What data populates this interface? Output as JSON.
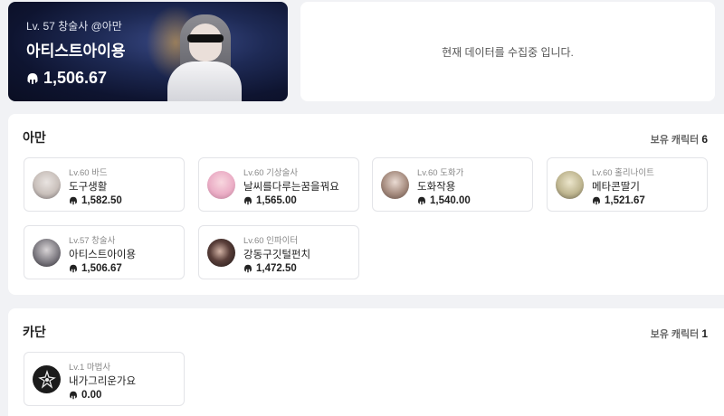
{
  "hero": {
    "meta": "Lv. 57 창술사 @아만",
    "name": "아티스트아이용",
    "item_level": "1,506.67",
    "icon": "helmet-icon"
  },
  "status": {
    "message": "현재 데이터를 수집중 입니다."
  },
  "servers": [
    {
      "name": "아만",
      "count_label": "보유 캐릭터",
      "count": "6",
      "characters": [
        {
          "level_class": "Lv.60 바드",
          "name": "도구생활",
          "item_level": "1,582.50",
          "avatar_color": "#d9d3cf"
        },
        {
          "level_class": "Lv.60 기상술사",
          "name": "날씨를다루는꿈을꿔요",
          "item_level": "1,565.00",
          "avatar_color": "#f0b9cf"
        },
        {
          "level_class": "Lv.60 도화가",
          "name": "도화작용",
          "item_level": "1,540.00",
          "avatar_color": "#b59a8c"
        },
        {
          "level_class": "Lv.60 홀리나이트",
          "name": "메타콘딸기",
          "item_level": "1,521.67",
          "avatar_color": "#cfc8a8"
        },
        {
          "level_class": "Lv.57 창술사",
          "name": "아티스트아이용",
          "item_level": "1,506.67",
          "avatar_color": "#7f7f86"
        },
        {
          "level_class": "Lv.60 인파이터",
          "name": "강동구깃털펀치",
          "item_level": "1,472.50",
          "avatar_color": "#3b2e2c"
        }
      ]
    },
    {
      "name": "카단",
      "count_label": "보유 캐릭터",
      "count": "1",
      "characters": [
        {
          "level_class": "Lv.1 마법사",
          "name": "내가그리운가요",
          "item_level": "0.00",
          "avatar_color": "#1b1b1b"
        }
      ]
    }
  ]
}
